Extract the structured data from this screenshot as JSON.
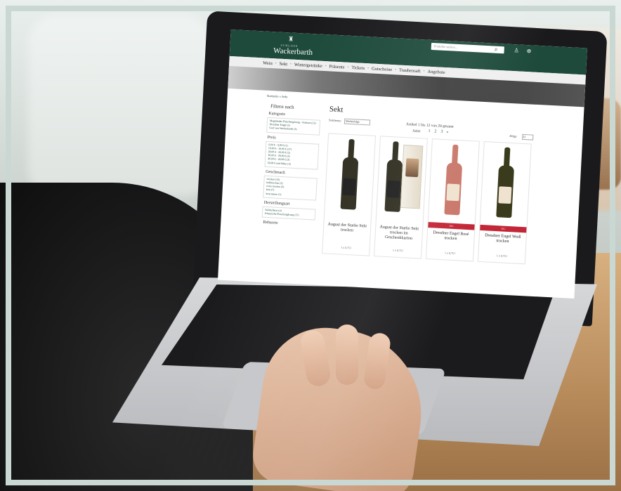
{
  "site": {
    "brand_small": "SCHLOSS",
    "brand": "Wackerbarth",
    "search_placeholder": "Produkte suchen...",
    "nav": [
      "Wein",
      "Sekt",
      "Wintergetränke",
      "Präsente",
      "Tickets",
      "Gutscheine",
      "Traubensaft",
      "Angebote"
    ],
    "breadcrumb": [
      "Startseite",
      "Sekt"
    ]
  },
  "sidebar": {
    "title": "Filtern nach",
    "groups": [
      {
        "label": "Kategorie",
        "items": [
          "Magnitudes Flaschengärung - Sachsen (12)",
          "Dresdner Engel (5)",
          "Graf von Wackerbarth (3)"
        ]
      },
      {
        "label": "Preis",
        "items": [
          "0,00 € - 9,99 € (1)",
          "10,00 € - 19,99 € (17)",
          "20,00 € - 29,99 € (2)",
          "30,00 € - 39,99 € (3)",
          "40,00 € - 49,99 € (3)",
          "50,00 € und höher (3)"
        ]
      },
      {
        "label": "Geschmack",
        "items": [
          "trocken (15)",
          "halbtrocken (3)",
          "extra trocken (3)",
          "brut (7)",
          "brut nature (1)"
        ]
      },
      {
        "label": "Herstellungsart",
        "items": [
          "Sektkellerei (4)",
          "Klassische Flaschengärung (17)"
        ]
      },
      {
        "label": "Rebsorte",
        "items": []
      }
    ]
  },
  "main": {
    "title": "Sekt",
    "sort_label": "Sortieren:",
    "sort_value": "Meilenfolge",
    "count_text": "Artikel 1 bis 12 von 29 gesamt",
    "page_label": "Seite",
    "pages": [
      "1",
      "2",
      "3",
      "»"
    ],
    "show_label": "Zeige",
    "show_value": "12",
    "products": [
      {
        "name": "August der Starke Sekt trocken",
        "size": "1 x 0,75 l",
        "bottle_color": "#2b2a1c",
        "label_color": "#1b1b1b",
        "gift": false,
        "ribbon": ""
      },
      {
        "name": "August der Starke Sekt trocken im Geschenkkarton",
        "size": "1 x 0,75 l",
        "bottle_color": "#2b2a1c",
        "label_color": "#1b1b1b",
        "gift": true,
        "ribbon": ""
      },
      {
        "name": "Dresdner Engel Rosé trocken",
        "size": "1 x 0,75 l",
        "bottle_color": "#c9776a",
        "label_color": "#efe3cf",
        "gift": false,
        "ribbon": "NEU"
      },
      {
        "name": "Dresdner Engel Weiß trocken",
        "size": "1 x 0,75 l",
        "bottle_color": "#3a3a1c",
        "label_color": "#efe3cf",
        "gift": false,
        "ribbon": "NEU"
      }
    ]
  },
  "colors": {
    "brand_green": "#1d4a3b",
    "ribbon_red": "#c32636"
  }
}
